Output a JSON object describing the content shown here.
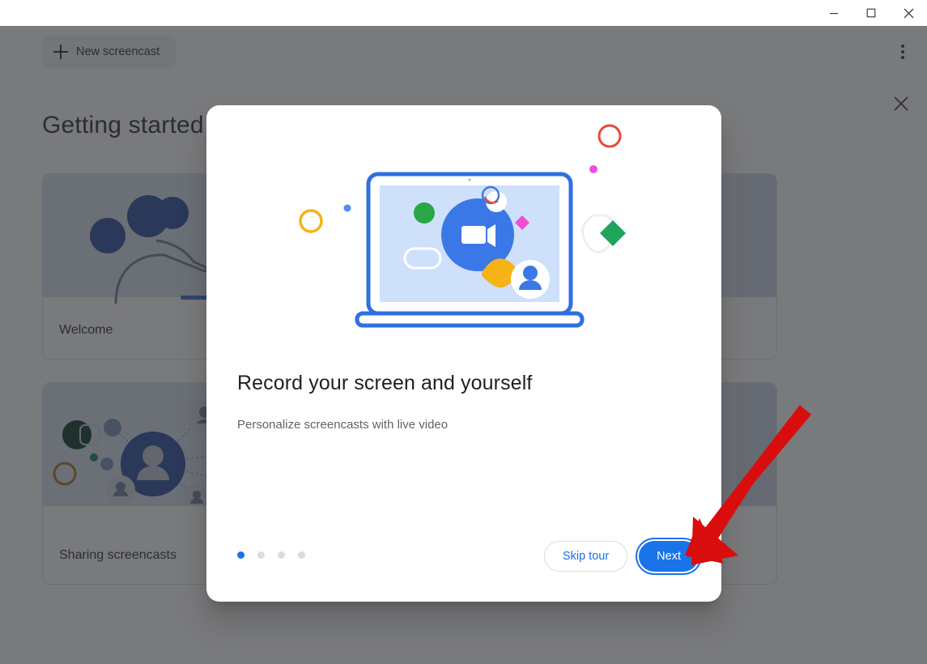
{
  "window": {
    "minimize_icon": "minimize-icon",
    "maximize_icon": "maximize-icon",
    "close_icon": "close-icon"
  },
  "page": {
    "new_screencast_label": "New screencast",
    "new_screencast_icon": "plus-icon",
    "overflow_menu_icon": "more-vert-icon",
    "close_icon": "close-icon",
    "title": "Getting started",
    "cards": [
      {
        "label": "Welcome",
        "thumb_icon": "person-writing-illustration"
      },
      {
        "label": "Sharing screencasts",
        "thumb_icon": "people-network-illustration"
      }
    ]
  },
  "dialog": {
    "hero_icon": "laptop-video-recording-illustration",
    "title": "Record your screen and yourself",
    "subtitle": "Personalize screencasts with live video",
    "pagination": {
      "total": 4,
      "active_index": 0
    },
    "skip_label": "Skip tour",
    "next_label": "Next"
  },
  "annotation": {
    "arrow_icon": "red-pointer-arrow",
    "color": "#d90d0d",
    "points_to": "Next"
  },
  "colors": {
    "accent_blue": "#1a73e8",
    "scrim": "rgba(32,33,36,0.60)",
    "text_primary": "#202124",
    "text_secondary": "#5f6368",
    "dot_inactive": "#dadce0",
    "thumb_bg": "#dbe3f0"
  }
}
